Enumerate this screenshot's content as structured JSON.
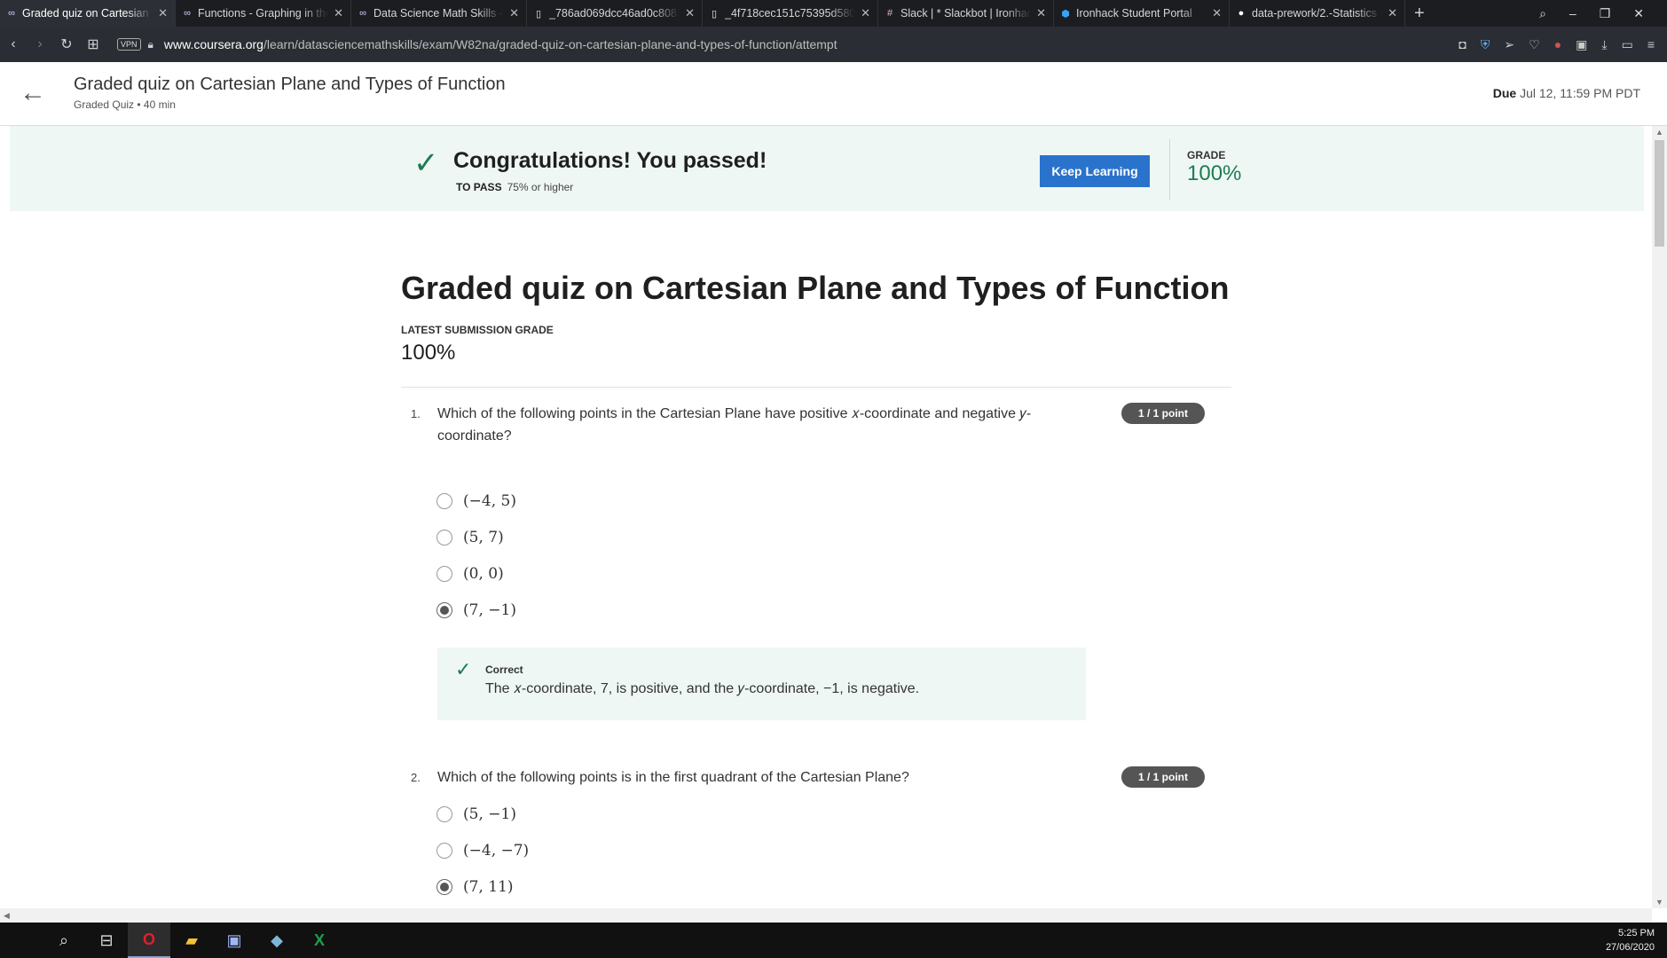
{
  "browser": {
    "tabs": [
      {
        "label": "Graded quiz on Cartesian Pl",
        "icon": "coursera-icon",
        "active": true
      },
      {
        "label": "Functions - Graphing in the",
        "icon": "coursera-icon",
        "active": false
      },
      {
        "label": "Data Science Math Skills - Ir",
        "icon": "coursera-icon",
        "active": false
      },
      {
        "label": "_786ad069dcc46ad0c8083f",
        "icon": "file-icon",
        "active": false
      },
      {
        "label": "_4f718cec151c75395d5800",
        "icon": "file-icon",
        "active": false
      },
      {
        "label": "Slack | * Slackbot | Ironhack",
        "icon": "slack-icon",
        "active": false
      },
      {
        "label": "Ironhack Student Portal",
        "icon": "ironhack-icon",
        "active": false
      },
      {
        "label": "data-prework/2.-Statistics a",
        "icon": "github-icon",
        "active": false
      }
    ],
    "vpn_label": "VPN",
    "url_host": "www.coursera.org",
    "url_path": "/learn/datasciencemathskills/exam/W82na/graded-quiz-on-cartesian-plane-and-types-of-function/attempt"
  },
  "header": {
    "title": "Graded quiz on Cartesian Plane and Types of Function",
    "subtitle": "Graded Quiz • 40 min",
    "due_label": "Due",
    "due_value": "Jul 12, 11:59 PM PDT"
  },
  "banner": {
    "title": "Congratulations! You passed!",
    "to_pass_label": "TO PASS",
    "to_pass_value": "75% or higher",
    "keep_learning": "Keep Learning",
    "grade_label": "GRADE",
    "grade_value": "100%",
    "accent": "#1d7c50"
  },
  "main": {
    "title": "Graded quiz on Cartesian Plane and Types of Function",
    "latest_label": "LATEST SUBMISSION GRADE",
    "latest_value": "100%"
  },
  "questions": [
    {
      "number": "1.",
      "text": "Which of the following points in the Cartesian Plane have positive 𝑥-coordinate and negative 𝑦-coordinate?",
      "points": "1 / 1 point",
      "options": [
        "(−4, 5)",
        "(5, 7)",
        "(0, 0)",
        "(7, −1)"
      ],
      "selected": 3,
      "feedback_label": "Correct",
      "feedback_text": "The 𝑥-coordinate, 7, is positive, and the 𝑦-coordinate, −1, is negative."
    },
    {
      "number": "2.",
      "text": "Which of the following points is in the first quadrant of the Cartesian Plane?",
      "points": "1 / 1 point",
      "options": [
        "(5, −1)",
        "(−4, −7)",
        "(7, 11)"
      ],
      "selected": 2
    }
  ],
  "taskbar": {
    "time": "5:25 PM",
    "date": "27/06/2020"
  }
}
